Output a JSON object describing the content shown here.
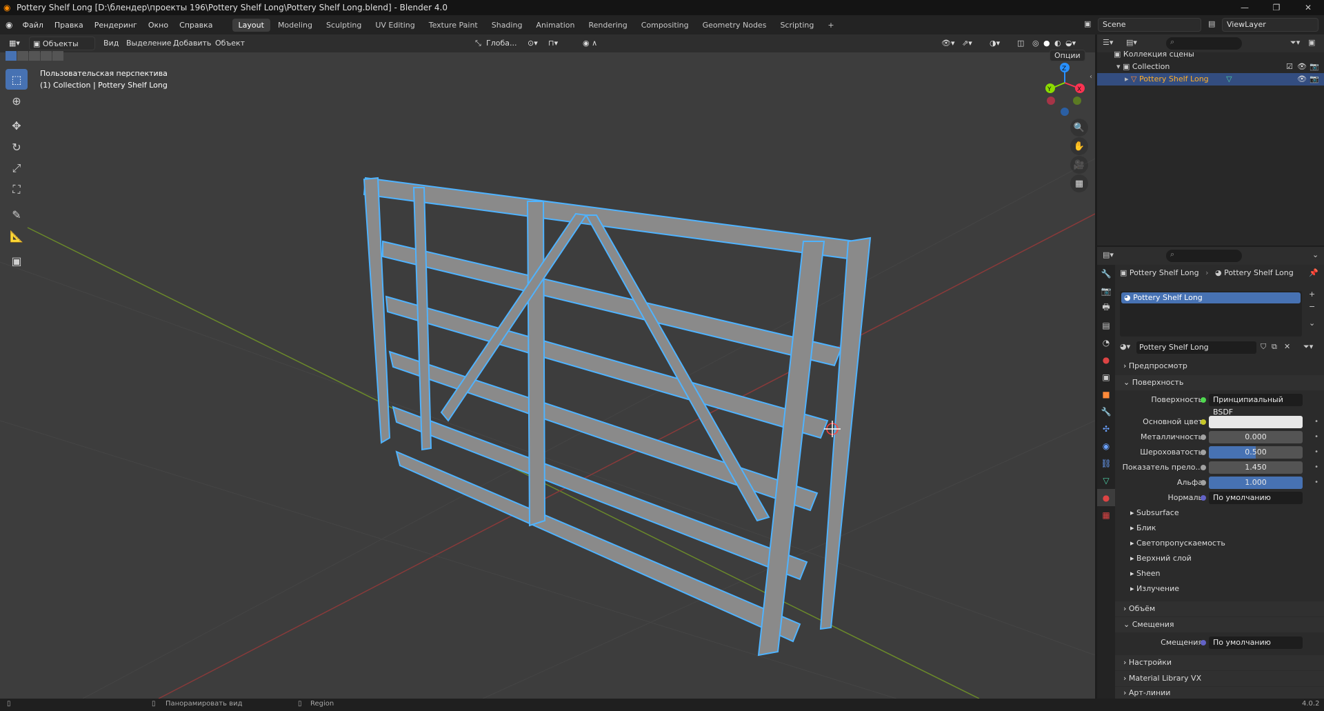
{
  "window": {
    "title": "Pottery Shelf Long [D:\\блендер\\проекты 196\\Pottery Shelf Long\\Pottery Shelf Long.blend] - Blender 4.0",
    "controls": [
      "—",
      "❐",
      "✕"
    ]
  },
  "menu": {
    "items": [
      "Файл",
      "Правка",
      "Рендеринг",
      "Окно",
      "Справка"
    ]
  },
  "workspaces": {
    "tabs": [
      "Layout",
      "Modeling",
      "Sculpting",
      "UV Editing",
      "Texture Paint",
      "Shading",
      "Animation",
      "Rendering",
      "Compositing",
      "Geometry Nodes",
      "Scripting"
    ],
    "active": "Layout",
    "add": "+"
  },
  "scene": {
    "name": "Scene",
    "view_layer": "ViewLayer"
  },
  "viewport_header": {
    "mode": "Объекты",
    "menus": [
      "Вид",
      "Выделение",
      "Добавить",
      "Объект"
    ],
    "transform_orientation": "Глоба...",
    "options": "Опции"
  },
  "viewport": {
    "view_name": "Пользовательская перспектива",
    "context": "(1) Collection | Pottery Shelf Long",
    "gizmo": {
      "x": "X",
      "y": "Y",
      "z": "Z"
    }
  },
  "outliner": {
    "root": "Коллекция сцены",
    "collection": "Collection",
    "object": "Pottery Shelf Long"
  },
  "properties": {
    "breadcrumb_object": "Pottery Shelf Long",
    "breadcrumb_material": "Pottery Shelf Long",
    "slot": "Pottery Shelf Long",
    "material_name": "Pottery Shelf Long",
    "sections": {
      "preview": "Предпросмотр",
      "surface": "Поверхность",
      "volume": "Объём",
      "displacement": "Смещения",
      "settings": "Настройки",
      "material_library": "Material Library VX",
      "lineart": "Арт-линии"
    },
    "surface": {
      "surface_label": "Поверхность",
      "surface_value": "Принципиальный BSDF",
      "base_color_label": "Основной цвет",
      "base_color": "#e8e8e8",
      "metallic_label": "Металличность",
      "metallic": "0.000",
      "roughness_label": "Шероховатость",
      "roughness": "0.500",
      "roughness_fraction": 0.5,
      "ior_label": "Показатель прело...",
      "ior": "1.450",
      "alpha_label": "Альфа",
      "alpha": "1.000",
      "alpha_fraction": 1.0,
      "normal_label": "Нормаль",
      "normal": "По умолчанию"
    },
    "subpanels": [
      "Subsurface",
      "Блик",
      "Светопропускаемость",
      "Верхний слой",
      "Sheen",
      "Излучение"
    ],
    "displacement": {
      "label": "Смещения",
      "value": "По умолчанию"
    }
  },
  "statusbar": {
    "pan_hint": "Панорамировать вид",
    "region": "Region",
    "version": "4.0.2"
  },
  "colors": {
    "accent": "#4772b3",
    "selection_outline": "#4fb3ff",
    "axis_x": "#ff3352",
    "axis_y": "#8bdc00",
    "axis_z": "#2890ff"
  }
}
